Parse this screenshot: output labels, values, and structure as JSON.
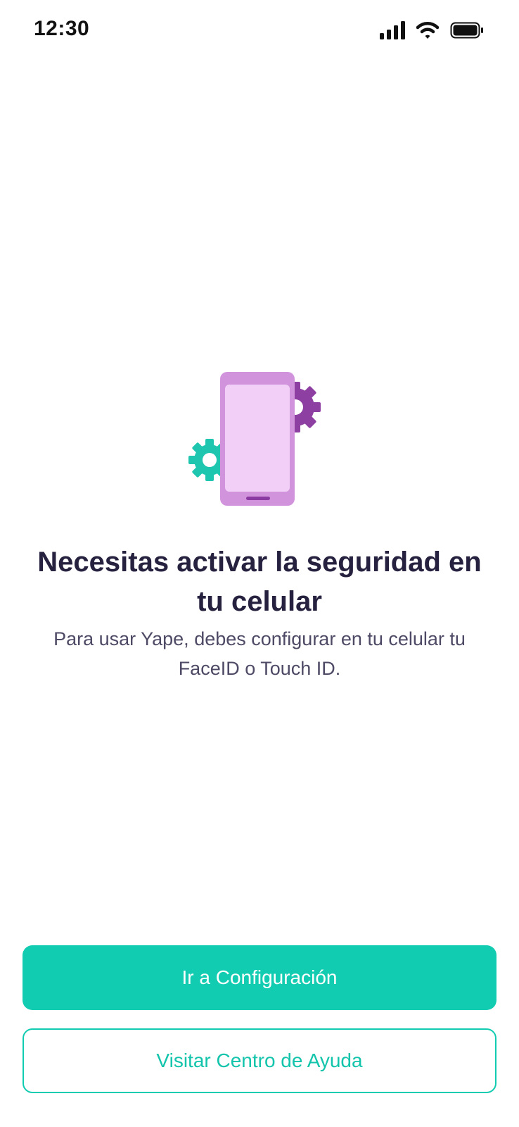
{
  "status_bar": {
    "time": "12:30",
    "icons": [
      "cellular-signal-icon",
      "wifi-icon",
      "battery-icon"
    ]
  },
  "illustration": {
    "icons": [
      "smartphone-icon",
      "gear-icon"
    ],
    "colors": {
      "phone_body": "#d193db",
      "phone_screen": "#f1cff6",
      "phone_home_bar": "#8a3aa0",
      "gear_purple": "#8d3fa2",
      "gear_teal": "#1ec6b0"
    }
  },
  "main": {
    "title": "Necesitas activar la seguridad en tu celular",
    "subtitle": "Para usar Yape, debes configurar en tu celular tu FaceID o Touch ID."
  },
  "actions": {
    "primary_label": "Ir a Configuración",
    "secondary_label": "Visitar Centro de Ayuda"
  },
  "colors": {
    "accent": "#12ccb1",
    "title_text": "#26213f",
    "body_text": "#4e4a66"
  }
}
